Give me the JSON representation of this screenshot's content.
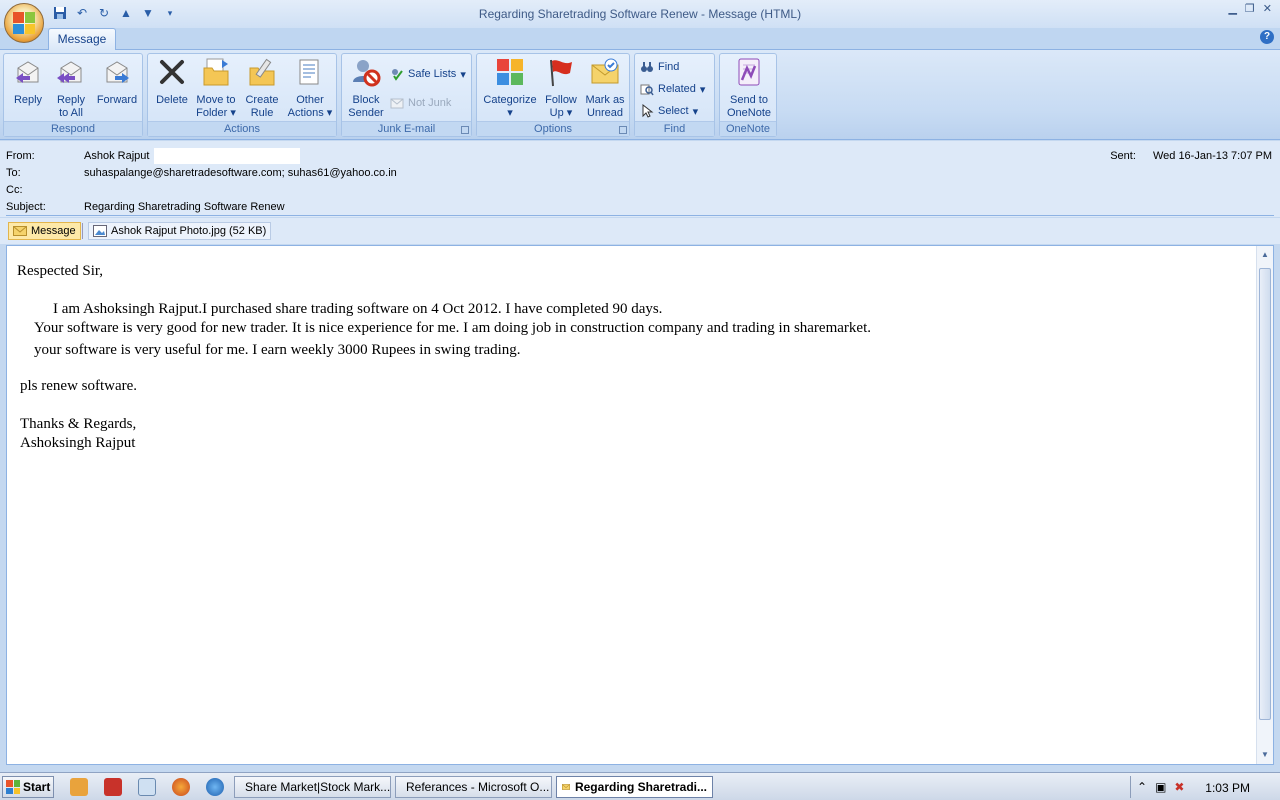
{
  "window": {
    "title": "Regarding Sharetrading Software Renew - Message (HTML)"
  },
  "ribbon": {
    "tab": "Message",
    "groups": {
      "respond": {
        "label": "Respond",
        "reply": "Reply",
        "reply_all_1": "Reply",
        "reply_all_2": "to All",
        "forward": "Forward"
      },
      "actions": {
        "label": "Actions",
        "delete": "Delete",
        "move_1": "Move to",
        "move_2": "Folder",
        "create_1": "Create",
        "create_2": "Rule",
        "other_1": "Other",
        "other_2": "Actions"
      },
      "junk": {
        "label": "Junk E-mail",
        "block_1": "Block",
        "block_2": "Sender",
        "safe_lists": "Safe Lists",
        "not_junk": "Not Junk"
      },
      "options": {
        "label": "Options",
        "categorize": "Categorize",
        "follow_1": "Follow",
        "follow_2": "Up",
        "mark_1": "Mark as",
        "mark_2": "Unread"
      },
      "find": {
        "label": "Find",
        "find": "Find",
        "related": "Related",
        "select": "Select"
      },
      "onenote": {
        "label": "OneNote",
        "send_1": "Send to",
        "send_2": "OneNote"
      }
    }
  },
  "header": {
    "from_label": "From:",
    "from_value": "Ashok Rajput",
    "to_label": "To:",
    "to_value": "suhaspalange@sharetradesoftware.com; suhas61@yahoo.co.in",
    "cc_label": "Cc:",
    "cc_value": "",
    "subject_label": "Subject:",
    "subject_value": "Regarding Sharetrading Software Renew",
    "sent_label": "Sent:",
    "sent_value": "Wed 16-Jan-13 7:07 PM"
  },
  "attachments": {
    "message_tab": "Message",
    "file": "Ashok Rajput Photo.jpg (52 KB)"
  },
  "body": {
    "greeting": "Respected Sir,",
    "line1": "I am Ashoksingh Rajput.I purchased share trading software on 4 Oct 2012. I have completed 90 days.",
    "line2": "Your software is very good for new trader. It is nice experience for me. I am doing job in construction company and trading in sharemarket.",
    "line3": "your software is very useful for me. I earn weekly 3000 Rupees in swing trading.",
    "line4": "pls renew software.",
    "closing": "Thanks & Regards,",
    "signature": "Ashoksingh Rajput"
  },
  "taskbar": {
    "start": "Start",
    "tasks": [
      "Share Market|Stock Mark...",
      "Referances - Microsoft O...",
      "Regarding Sharetradi..."
    ],
    "clock": "1:03 PM"
  }
}
